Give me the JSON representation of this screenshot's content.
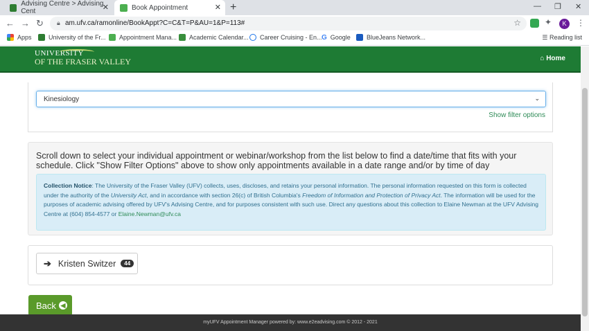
{
  "browser": {
    "tabs": [
      {
        "title": "Advising Centre > Advising Cent",
        "favicon_color": "#2e7d32"
      },
      {
        "title": "Book Appointment",
        "favicon_color": "#4caf50"
      }
    ],
    "url": "am.ufv.ca/ramonline/BookAppt?C=C&T=P&AU=1&P=113#",
    "avatar_letter": "K",
    "bookmarks": [
      {
        "label": "Apps",
        "icon": "apps-grid-icon"
      },
      {
        "label": "University of the Fr...",
        "icon": "ufv-icon"
      },
      {
        "label": "Appointment Mana...",
        "icon": "appointment-icon"
      },
      {
        "label": "Academic Calendar...",
        "icon": "calendar-icon"
      },
      {
        "label": "Career Cruising - En...",
        "icon": "career-icon"
      },
      {
        "label": "Google",
        "icon": "google-icon"
      },
      {
        "label": "BlueJeans Network...",
        "icon": "bluejeans-icon"
      }
    ],
    "reading_list": "Reading list"
  },
  "site": {
    "logo_line1": "UNIVERSITY",
    "logo_line2": "OF THE FRASER VALLEY",
    "home_label": "Home",
    "brand_color": "#1e7b34"
  },
  "filter": {
    "selected_program": "Kinesiology",
    "show_filter_label": "Show filter options"
  },
  "instructions": "Scroll down to select your individual appointment or webinar/workshop from the list below to find a date/time that fits with your schedule. Click \"Show Filter Options\" above to show only appointments available in a date range and/or by time of day",
  "notice": {
    "heading": "Collection Notice",
    "part1": ": The University of the Fraser Valley (UFV) collects, uses, discloses, and retains your personal information. The personal information requested on this form is collected under the authority of the ",
    "act1": "University Act",
    "part2": ", and in accordance with section 26(c) of British Columbia's ",
    "act2": "Freedom of Information and Protection of Privacy Act",
    "part3": ". The information will be used for the purposes of academic advising offered by UFV's Advising Centre, and for purposes consistent with such use. Direct any questions about this collection to Elaine Newman at the UFV Advising Centre at (604) 854-4577 or ",
    "email": "Elaine.Newman@ufv.ca"
  },
  "advisors": [
    {
      "name": "Kristen Switzer",
      "count": "44"
    }
  ],
  "back_label": "Back",
  "footer": "myUFV Appointment Manager powered by: www.e2eadvising.com © 2012 - 2021"
}
